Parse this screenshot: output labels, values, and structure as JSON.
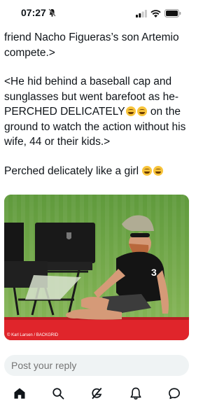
{
  "status_bar": {
    "time": "07:27"
  },
  "post": {
    "line1": "friend Nacho Figueras’s son Artemio compete.>",
    "quote_part1": "<He hid behind a baseball cap and sunglasses but went barefoot as he-PERCHED DELICATELY",
    "quote_part2": " on the ground to watch the action without his wife, 44 or their kids.>",
    "comment": "Perched delicately like a girl"
  },
  "photo": {
    "credit": "© Karl Larsen / BACKGRID",
    "shirt_number": "3"
  },
  "reply": {
    "placeholder": "Post your reply"
  },
  "tabs": [
    "home-icon",
    "search-icon",
    "grok-icon",
    "notifications-icon",
    "messages-icon"
  ]
}
